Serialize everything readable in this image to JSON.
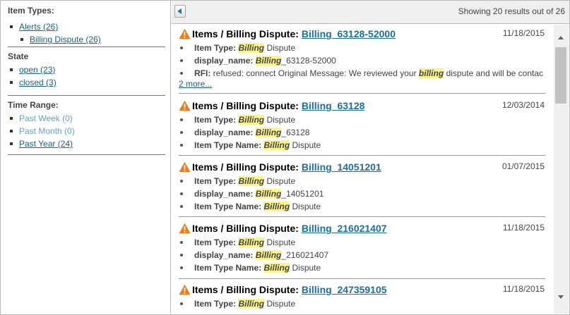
{
  "sidebar": {
    "item_types": {
      "title": "Item Types:",
      "items": [
        {
          "label": "Alerts (26)"
        },
        {
          "label": "Billing Dispute (26)"
        }
      ]
    },
    "state": {
      "title": "State",
      "items": [
        {
          "label": "open (23)"
        },
        {
          "label": "closed (3)"
        }
      ]
    },
    "time_range": {
      "title": "Time Range:",
      "items": [
        {
          "label": "Past Week (0)",
          "enabled": false
        },
        {
          "label": "Past Month (0)",
          "enabled": false
        },
        {
          "label": "Past Year (24)",
          "enabled": true
        }
      ]
    }
  },
  "toolbar": {
    "back_icon": "triangle-left-icon",
    "result_count": "Showing 20 results out of 26"
  },
  "results": [
    {
      "prefix": "Items / Billing Dispute:",
      "link": "Billing_63128-52000",
      "date": "11/18/2015",
      "fields": [
        {
          "label": "Item Type:",
          "highlight": "Billing",
          "rest": " Dispute"
        },
        {
          "label": "display_name:",
          "highlight": "Billing",
          "rest": "_63128-52000"
        },
        {
          "label": "RFI:",
          "pre": " refused: connect Original Message: We reviewed your ",
          "highlight": "billing",
          "rest": " dispute and will be contacting"
        }
      ],
      "more": "2 more..."
    },
    {
      "prefix": "Items / Billing Dispute:",
      "link": "Billing_63128",
      "date": "12/03/2014",
      "fields": [
        {
          "label": "Item Type:",
          "highlight": "Billing",
          "rest": " Dispute"
        },
        {
          "label": "display_name:",
          "highlight": "Billing",
          "rest": "_63128"
        },
        {
          "label": "Item Type Name:",
          "highlight": "Billing",
          "rest": " Dispute"
        }
      ]
    },
    {
      "prefix": "Items / Billing Dispute:",
      "link": "Billing_14051201",
      "date": "01/07/2015",
      "fields": [
        {
          "label": "Item Type:",
          "highlight": "Billing",
          "rest": " Dispute"
        },
        {
          "label": "display_name:",
          "highlight": "Billing",
          "rest": "_14051201"
        },
        {
          "label": "Item Type Name:",
          "highlight": "Billing",
          "rest": " Dispute"
        }
      ]
    },
    {
      "prefix": "Items / Billing Dispute:",
      "link": "Billing_216021407",
      "date": "11/18/2015",
      "fields": [
        {
          "label": "Item Type:",
          "highlight": "Billing",
          "rest": " Dispute"
        },
        {
          "label": "display_name:",
          "highlight": "Billing",
          "rest": "_216021407"
        },
        {
          "label": "Item Type Name:",
          "highlight": "Billing",
          "rest": " Dispute"
        }
      ]
    },
    {
      "prefix": "Items / Billing Dispute:",
      "link": "Billing_247359105",
      "date": "11/18/2015",
      "fields": [
        {
          "label": "Item Type:",
          "highlight": "Billing",
          "rest": " Dispute"
        }
      ]
    }
  ],
  "icons": {
    "result_icon": "warning-triangle-icon",
    "scroll_up": "scroll-up-arrow-icon",
    "scroll_down": "scroll-down-arrow-icon"
  },
  "colors": {
    "link": "#1a6fa0",
    "highlight": "#fbf48b",
    "warning_icon": "#f07a17",
    "toolbar_bg": "#efefef"
  }
}
